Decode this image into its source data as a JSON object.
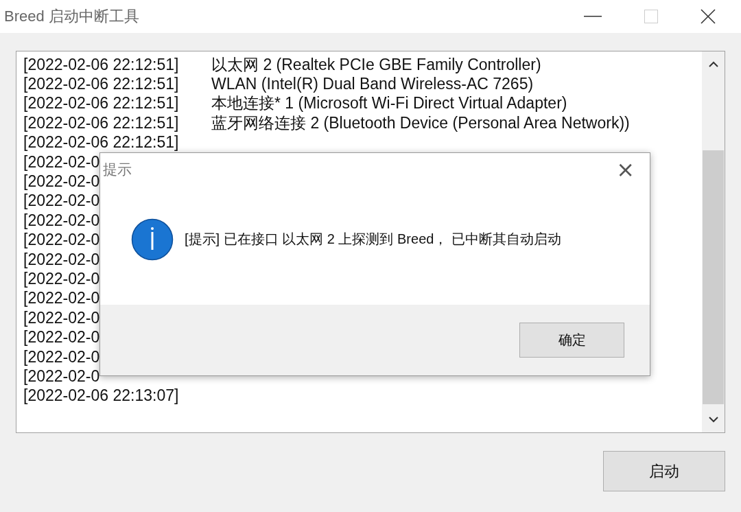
{
  "window": {
    "title": "Breed 启动中断工具"
  },
  "log": [
    {
      "time": "[2022-02-06 22:12:51]",
      "message": "以太网 2 (Realtek PCIe GBE Family Controller)"
    },
    {
      "time": "[2022-02-06 22:12:51]",
      "message": "WLAN (Intel(R) Dual Band Wireless-AC 7265)"
    },
    {
      "time": "[2022-02-06 22:12:51]",
      "message": "本地连接* 1 (Microsoft Wi-Fi Direct Virtual Adapter)"
    },
    {
      "time": "[2022-02-06 22:12:51]",
      "message": "蓝牙网络连接 2 (Bluetooth Device (Personal Area Network))"
    },
    {
      "time": "[2022-02-06 22:12:51]"
    },
    {
      "time": "[2022-02-0"
    },
    {
      "time": "[2022-02-0"
    },
    {
      "time": "[2022-02-0"
    },
    {
      "time": "[2022-02-0"
    },
    {
      "time": "[2022-02-0"
    },
    {
      "time": "[2022-02-0"
    },
    {
      "time": "[2022-02-0"
    },
    {
      "time": "[2022-02-0"
    },
    {
      "time": "[2022-02-0"
    },
    {
      "time": "[2022-02-0"
    },
    {
      "time": "[2022-02-0"
    },
    {
      "time": "[2022-02-0"
    },
    {
      "time": "[2022-02-06 22:13:07]"
    }
  ],
  "start_button": "启动",
  "dialog": {
    "title": "提示",
    "close": "×",
    "message": "[提示] 已在接口 以太网 2 上探测到 Breed， 已中断其自动启动",
    "ok_button": "确定"
  }
}
